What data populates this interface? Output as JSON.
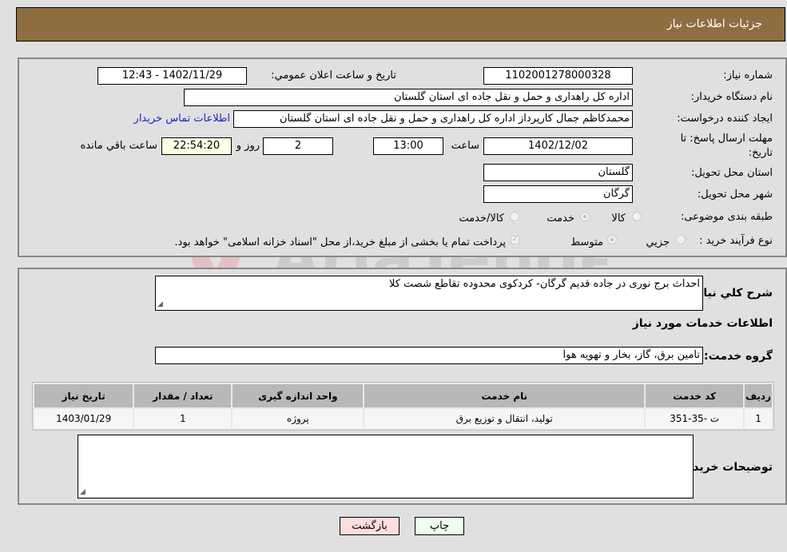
{
  "header": {
    "title": "جزئیات اطلاعات نیاز"
  },
  "form": {
    "need_number_label": "شماره نیاز:",
    "need_number": "1102001278000328",
    "announce_label": "تاريخ و ساعت اعلان عمومي:",
    "announce_value": "1402/11/29 - 12:43",
    "buyer_org_label": "نام دستگاه خريدار:",
    "buyer_org": "اداره کل راهداری و حمل و نقل جاده ای استان گلستان",
    "creator_label": "ايجاد کننده درخواست:",
    "creator": "محمدکاظم جمال کارپرداز اداره کل راهداری و حمل و نقل جاده ای استان گلستان",
    "contact_link": "اطلاعات تماس خريدار",
    "deadline_label_1": "مهلت ارسال پاسخ: تا",
    "deadline_label_2": "تاریخ:",
    "deadline_date": "1402/12/02",
    "time_label": "ساعت",
    "deadline_time": "13:00",
    "days": "2",
    "days_label": "روز و",
    "remaining_time": "22:54:20",
    "remaining_label": "ساعت باقي مانده",
    "province_label": "استان محل تحويل:",
    "province": "گلستان",
    "city_label": "شهر محل تحويل:",
    "city": "گرگان",
    "category_label": "طبقه بندی موضوعی:",
    "category_options": [
      "کالا",
      "خدمت",
      "کالا/خدمت"
    ],
    "category_selected": "خدمت",
    "process_label": "نوع فرآيند خريد :",
    "process_options": [
      "جزيي",
      "متوسط"
    ],
    "process_selected": "متوسط",
    "payment_note": "پرداخت تمام يا بخشی از مبلغ خريد،از محل \"اسناد خزانه اسلامی\" خواهد بود."
  },
  "details": {
    "description_label": "شرح كلي نياز:",
    "description": "احداث برج نوری در جاده قدیم گرگان- کردکوی محدوده تقاطع شصت کلا",
    "services_title": "اطلاعات خدمات مورد نياز",
    "service_group_label": "گروه خدمت:",
    "service_group": "تامین برق، گاز، بخار و تهویه هوا",
    "table": {
      "headers": [
        "رديف",
        "كد خدمت",
        "نام خدمت",
        "واحد اندازه گيری",
        "تعداد / مقدار",
        "تاريخ نياز"
      ],
      "rows": [
        [
          "1",
          "ت -35-351",
          "تولید، انتقال و توزیع برق",
          "پروژه",
          "1",
          "1403/01/29"
        ]
      ]
    },
    "buyer_notes_label": "توضيحات خريدار:",
    "buyer_notes": ""
  },
  "buttons": {
    "print": "چاپ",
    "back": "بازگشت"
  },
  "watermark": "AriaTender.neT",
  "colors": {
    "header_bg": "#8d6e41",
    "print_bg": "#eeffee",
    "back_bg": "#ffdddd",
    "link": "#2020cc"
  }
}
